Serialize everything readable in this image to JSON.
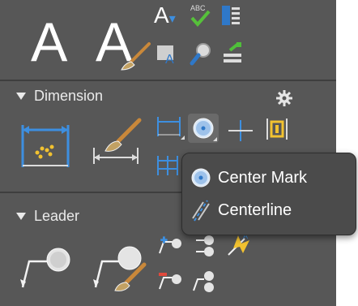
{
  "text_section": {
    "icons": [
      "text-multiline-icon",
      "text-edit-icon",
      "text-single-icon",
      "spell-check-icon",
      "text-align-icon",
      "text-mask-icon",
      "find-text-icon",
      "text-style-icon"
    ]
  },
  "dimension": {
    "title": "Dimension",
    "icons": [
      "dimension-linear-icon",
      "dimension-style-icon",
      "dimension-continue-icon",
      "center-mark-icon",
      "dimension-break-icon",
      "dimension-inspect-icon",
      "dimension-baseline-icon",
      "settings-gear-icon"
    ]
  },
  "flyout": {
    "items": [
      {
        "label": "Center Mark",
        "icon": "center-mark-icon"
      },
      {
        "label": "Centerline",
        "icon": "centerline-icon"
      }
    ]
  },
  "leader": {
    "title": "Leader",
    "icons": [
      "multileader-icon",
      "multileader-style-icon",
      "add-leader-icon",
      "align-leaders-icon",
      "remove-leader-icon",
      "collect-leaders-icon",
      "leader-extra-icon"
    ]
  },
  "colors": {
    "panel": "#575757",
    "popup": "#4b4b4b",
    "accent_blue": "#3d8fe0",
    "text": "#eaeaea"
  }
}
